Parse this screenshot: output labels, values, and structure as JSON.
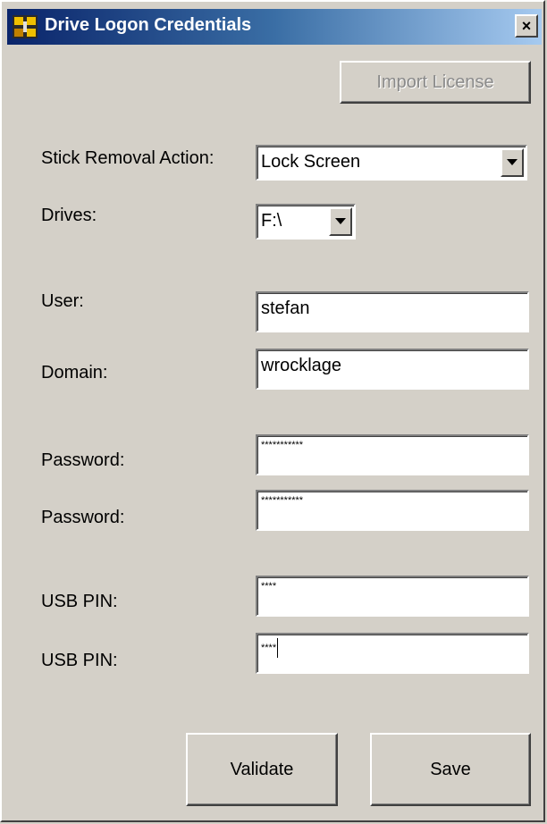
{
  "window": {
    "title": "Drive Logon Credentials",
    "close_glyph": "×",
    "title_gradient": [
      "#0a246a",
      "#a6caf0"
    ]
  },
  "buttons": {
    "import_license": "Import License",
    "validate": "Validate",
    "save": "Save"
  },
  "form": {
    "removal_action_label": "Stick Removal Action:",
    "removal_action_value": "Lock Screen",
    "drives_label": "Drives:",
    "drives_value": "F:\\",
    "user_label": "User:",
    "user_value": "stefan",
    "domain_label": "Domain:",
    "domain_value": "wrocklage",
    "password_label": "Password:",
    "password_value": "***********",
    "password_confirm_label": "Password:",
    "password_confirm_value": "***********",
    "pin_label": "USB PIN:",
    "pin_value": "****",
    "pin_confirm_label": "USB PIN:",
    "pin_confirm_value": "****"
  },
  "icons": {
    "app": "drive-credentials-icon",
    "dropdown": "chevron-down-icon"
  }
}
